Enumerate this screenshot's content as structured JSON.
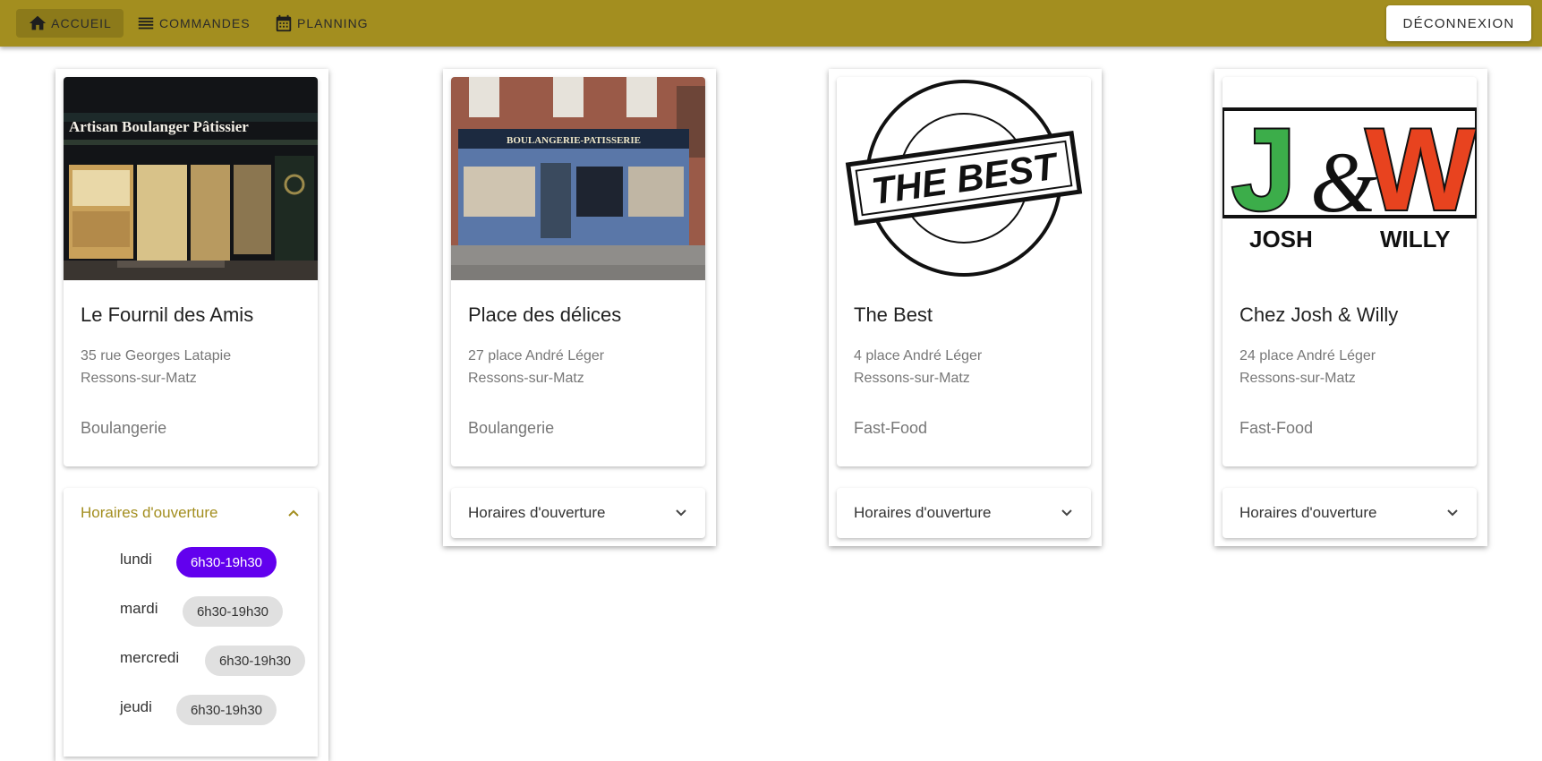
{
  "nav": {
    "items": [
      {
        "label": "Accueil",
        "icon": "home-icon",
        "active": true
      },
      {
        "label": "Commandes",
        "icon": "list-icon",
        "active": false
      },
      {
        "label": "Planning",
        "icon": "calendar-icon",
        "active": false
      }
    ],
    "logout_label": "Déconnexion"
  },
  "colors": {
    "topbar": "#a38e1f",
    "selected_chip": "#6200ee"
  },
  "restaurants": [
    {
      "name": "Le Fournil des Amis",
      "address_line1": "35 rue Georges Latapie",
      "address_line2": "Ressons-sur-Matz",
      "category": "Boulangerie",
      "image_sign": "Artisan  Boulanger  Pâtissier",
      "hours_label": "Horaires d'ouverture",
      "expanded": true
    },
    {
      "name": "Place des délices",
      "address_line1": "27 place André Léger",
      "address_line2": "Ressons-sur-Matz",
      "category": "Boulangerie",
      "image_sign": "BOULANGERIE-PATISSERIE",
      "hours_label": "Horaires d'ouverture",
      "expanded": false
    },
    {
      "name": "The Best",
      "address_line1": "4 place André Léger",
      "address_line2": "Ressons-sur-Matz",
      "category": "Fast-Food",
      "image_sign": "THE BEST",
      "hours_label": "Horaires d'ouverture",
      "expanded": false
    },
    {
      "name": "Chez Josh & Willy",
      "address_line1": "24 place André Léger",
      "address_line2": "Ressons-sur-Matz",
      "category": "Fast-Food",
      "image_sign": "J&W",
      "logo_sub_left": "JOSH",
      "logo_sub_right": "WILLY",
      "hours_label": "Horaires d'ouverture",
      "expanded": false
    }
  ],
  "hours": [
    {
      "day": "lundi",
      "time": "6h30-19h30",
      "selected": true
    },
    {
      "day": "mardi",
      "time": "6h30-19h30",
      "selected": false
    },
    {
      "day": "mercredi",
      "time": "6h30-19h30",
      "selected": false
    },
    {
      "day": "jeudi",
      "time": "6h30-19h30",
      "selected": false
    }
  ]
}
